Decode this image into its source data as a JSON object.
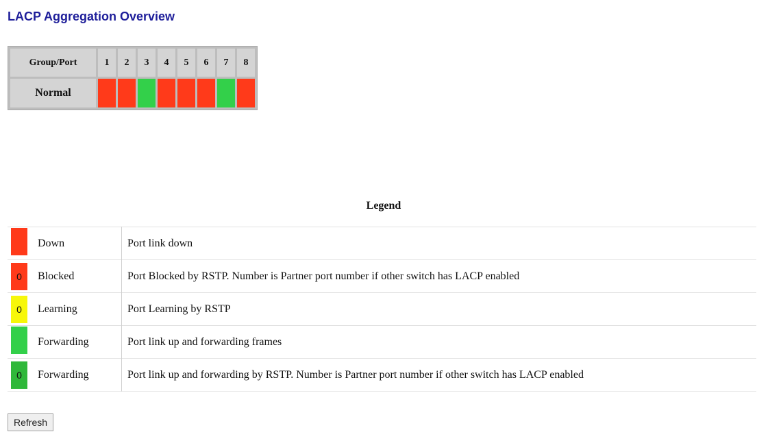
{
  "page": {
    "title": "LACP Aggregation Overview"
  },
  "port_table": {
    "header_label": "Group/Port",
    "ports": [
      "1",
      "2",
      "3",
      "4",
      "5",
      "6",
      "7",
      "8"
    ],
    "groups": [
      {
        "name": "Normal",
        "statuses": [
          "down",
          "down",
          "forwarding",
          "down",
          "down",
          "down",
          "forwarding",
          "down"
        ]
      }
    ]
  },
  "legend": {
    "title": "Legend",
    "items": [
      {
        "swatch_color": "#ff3a1a",
        "swatch_text": "",
        "state": "Down",
        "description": "Port link down"
      },
      {
        "swatch_color": "#ff3a1a",
        "swatch_text": "0",
        "state": "Blocked",
        "description": "Port Blocked by RSTP. Number is Partner port number if other switch has LACP enabled"
      },
      {
        "swatch_color": "#f7f70a",
        "swatch_text": "0",
        "state": "Learning",
        "description": "Port Learning by RSTP"
      },
      {
        "swatch_color": "#33d04a",
        "swatch_text": "",
        "state": "Forwarding",
        "description": "Port link up and forwarding frames"
      },
      {
        "swatch_color": "#2fb83a",
        "swatch_text": "0",
        "state": "Forwarding",
        "description": "Port link up and forwarding by RSTP. Number is Partner port number if other switch has LACP enabled"
      }
    ]
  },
  "actions": {
    "refresh_label": "Refresh"
  },
  "colors": {
    "title": "#1e1e9a",
    "down": "#ff3a1a",
    "forwarding": "#33d04a",
    "learning": "#f7f70a"
  }
}
